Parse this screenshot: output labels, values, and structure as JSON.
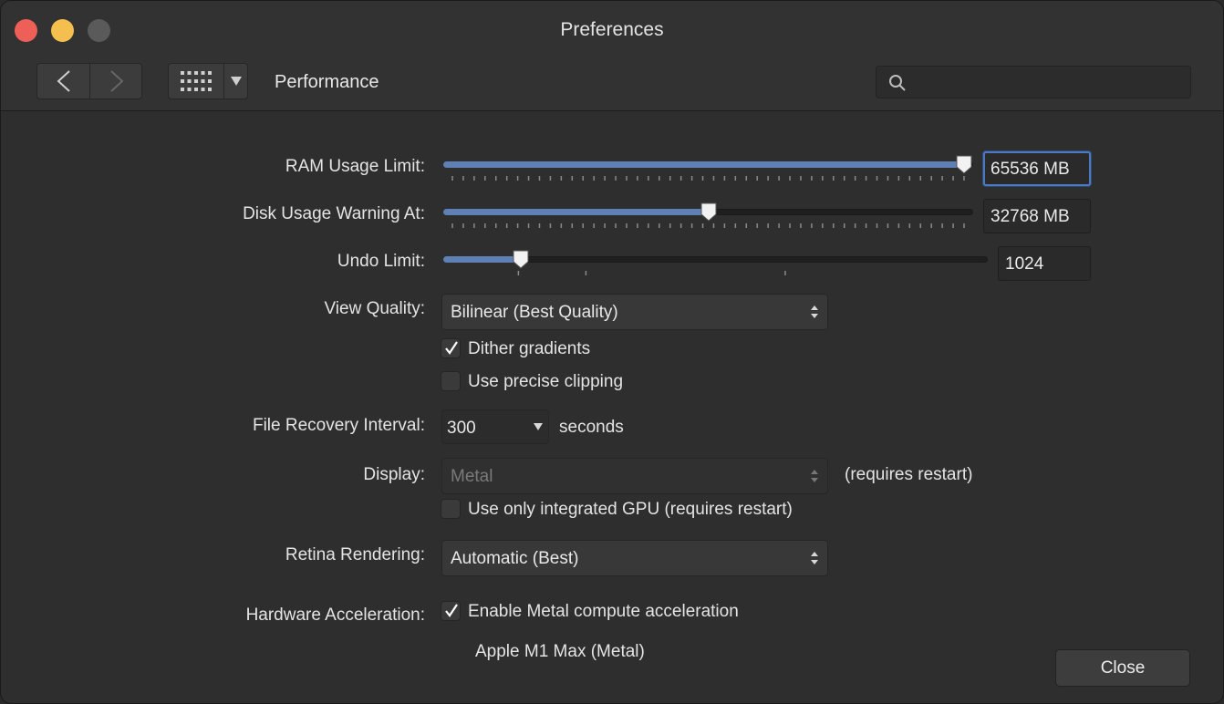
{
  "window": {
    "title": "Preferences"
  },
  "toolbar": {
    "page_name": "Performance",
    "search_placeholder": ""
  },
  "settings": {
    "ram": {
      "label": "RAM Usage Limit:",
      "value": "65536 MB",
      "fraction": 1.0
    },
    "disk": {
      "label": "Disk Usage Warning At:",
      "value": "32768 MB",
      "fraction": 0.5
    },
    "undo": {
      "label": "Undo Limit:",
      "value": "1024",
      "fraction": 0.13
    },
    "view_quality": {
      "label": "View Quality:",
      "value": "Bilinear (Best Quality)"
    },
    "dither": {
      "label": "Dither gradients",
      "checked": true
    },
    "precise_clipping": {
      "label": "Use precise clipping",
      "checked": false
    },
    "file_recovery": {
      "label": "File Recovery Interval:",
      "value": "300",
      "unit": "seconds"
    },
    "display": {
      "label": "Display:",
      "value": "Metal",
      "note": "(requires restart)"
    },
    "integrated_gpu": {
      "label": "Use only integrated GPU (requires restart)",
      "checked": false
    },
    "retina": {
      "label": "Retina Rendering:",
      "value": "Automatic (Best)"
    },
    "hw_accel": {
      "label": "Hardware Acceleration:",
      "checkbox_label": "Enable Metal compute acceleration",
      "checked": true,
      "device": "Apple M1 Max (Metal)"
    }
  },
  "buttons": {
    "close": "Close"
  },
  "colors": {
    "accent": "#5f80b4",
    "focus": "#4d79c1",
    "close": "#ee5f57",
    "minimize": "#f5bf4f"
  }
}
